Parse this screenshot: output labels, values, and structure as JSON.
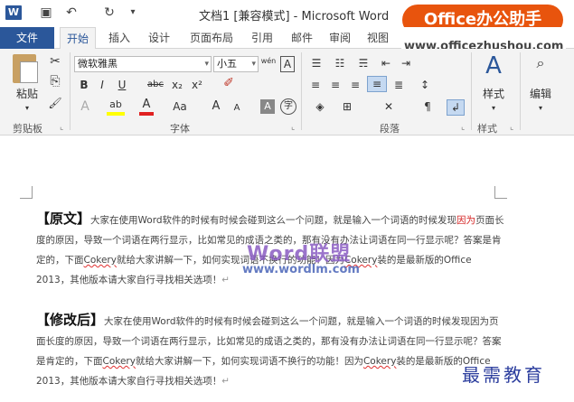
{
  "titlebar": {
    "logo": "W",
    "title": "文档1 [兼容模式] - Microsoft Word",
    "qat_icons": [
      "save-icon",
      "undo-icon",
      "redo-icon",
      "customize-qat-icon"
    ],
    "qat_glyphs": [
      "▣",
      "↶",
      "↻",
      "▾"
    ],
    "brand": "Office办公助手",
    "brand_url": "www.officezhushou.com"
  },
  "tabs": [
    {
      "label": "文件"
    },
    {
      "label": "开始"
    },
    {
      "label": "插入"
    },
    {
      "label": "设计"
    },
    {
      "label": "页面布局"
    },
    {
      "label": "引用"
    },
    {
      "label": "邮件"
    },
    {
      "label": "审阅"
    },
    {
      "label": "视图"
    }
  ],
  "ribbon": {
    "clipboard": {
      "paste_label": "粘贴",
      "group_label": "剪贴板",
      "cut_glyph": "✂",
      "copy_glyph": "⎘",
      "painter_glyph": "🖌"
    },
    "font": {
      "family": "微软雅黑",
      "size": "小五",
      "phonetic_glyph": "wén",
      "border_glyph": "A",
      "bold": "B",
      "italic": "I",
      "underline": "U",
      "strikethrough": "abc",
      "subscript": "x₂",
      "superscript": "x²",
      "clear_glyph": "✐",
      "effects": "A",
      "highlight": "ab",
      "color": "A",
      "case": "Aa",
      "grow": "A",
      "shrink": "A",
      "shade": "A",
      "encircle": "字",
      "group_label": "字体"
    },
    "paragraph": {
      "group_label": "段落"
    },
    "styles": {
      "label": "样式",
      "group_label": "样式"
    },
    "editing": {
      "label": "编辑"
    },
    "launcher_glyph": "⌞"
  },
  "document": {
    "para1": {
      "head": "【原文】",
      "text_a": "大家在使用Word软件的时候有时候会碰到这么一个问题，就是输入一个词语的时候发现",
      "text_red": "因为",
      "text_b": "页面长度的原因，导致一个词语在两行显示，比如常见的成语之类的，那有没有办法让词语在同一行显示呢？答案是肯定的，下面",
      "squig1": "Cokery",
      "text_c": "就给大家讲解一下，如何实现词语不换行的功能！因为",
      "squig2": "Cokery",
      "text_d": "装的是最新版的Office 2013，其他版本请大家自行寻找相关选项！",
      "mark": "↵"
    },
    "para2": {
      "head": "【修改后】",
      "text_a": "大家在使用Word软件的时候有时候会碰到这么一个问题，就是输入一个词语的时候发现因为页面长度的原因，导致一个词语在两行显示，比如常见的成语之类的，那有没有办法让词语在同一行显示呢？答案是肯定的，下面",
      "squig1": "Cokery",
      "text_b": "就给大家讲解一下，如何实现词语不换行的功能！因为",
      "squig2": "Cokery",
      "text_c": "装的是最新版的Office 2013，其他版本请大家自行寻找相关选项！",
      "mark": "↵"
    },
    "watermark_1": "Word联盟",
    "watermark_2": "www.wordlm.com",
    "stamp": "最需教育"
  }
}
